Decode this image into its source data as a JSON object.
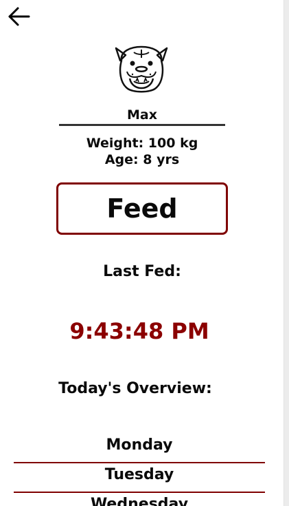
{
  "header": {
    "back_icon": "arrow-left-icon"
  },
  "pet": {
    "avatar_icon": "dog-face-icon",
    "name": "Max",
    "weight": "Weight: 100 kg",
    "age": "Age: 8 yrs"
  },
  "actions": {
    "feed_label": "Feed"
  },
  "last_fed": {
    "label": "Last Fed:",
    "time": "9:43:48 PM"
  },
  "overview": {
    "title": "Today's Overview:",
    "days": [
      "Monday",
      "Tuesday",
      "Wednesday"
    ]
  },
  "colors": {
    "accent": "#8b0000",
    "divider": "#333333"
  }
}
